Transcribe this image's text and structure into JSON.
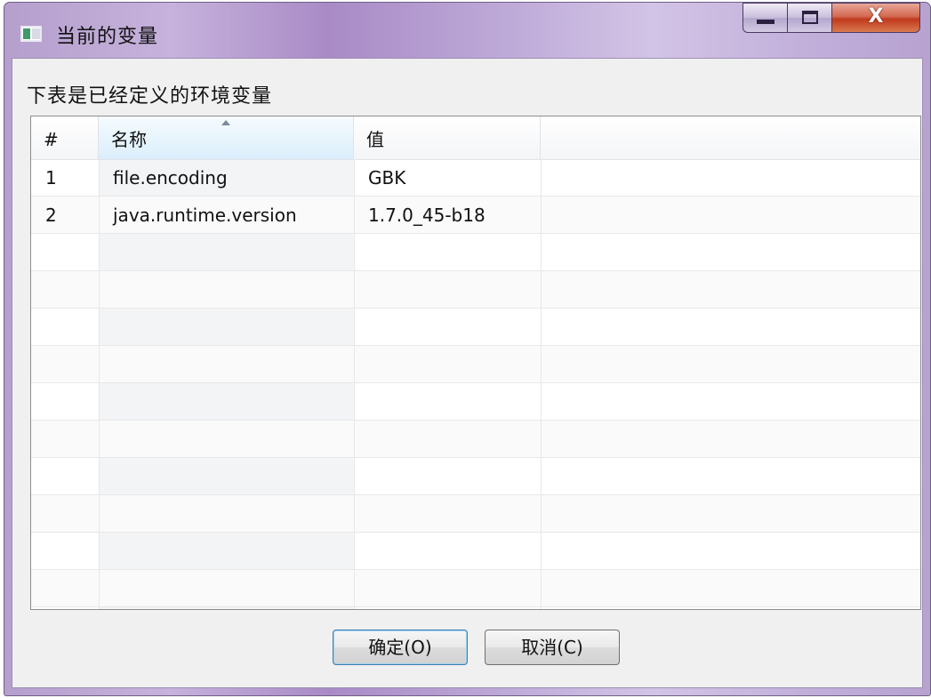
{
  "window": {
    "title": "当前的变量",
    "close_label": "X"
  },
  "dialog": {
    "description": "下表是已经定义的环境变量"
  },
  "table": {
    "columns": [
      "#",
      "名称",
      "值",
      ""
    ],
    "sorted_column": "名称",
    "rows": [
      [
        "1",
        "file.encoding",
        "GBK"
      ],
      [
        "2",
        "java.runtime.version",
        "1.7.0_45-b18"
      ]
    ]
  },
  "buttons": {
    "ok_label": "确定(O)",
    "cancel_label": "取消(C)"
  }
}
